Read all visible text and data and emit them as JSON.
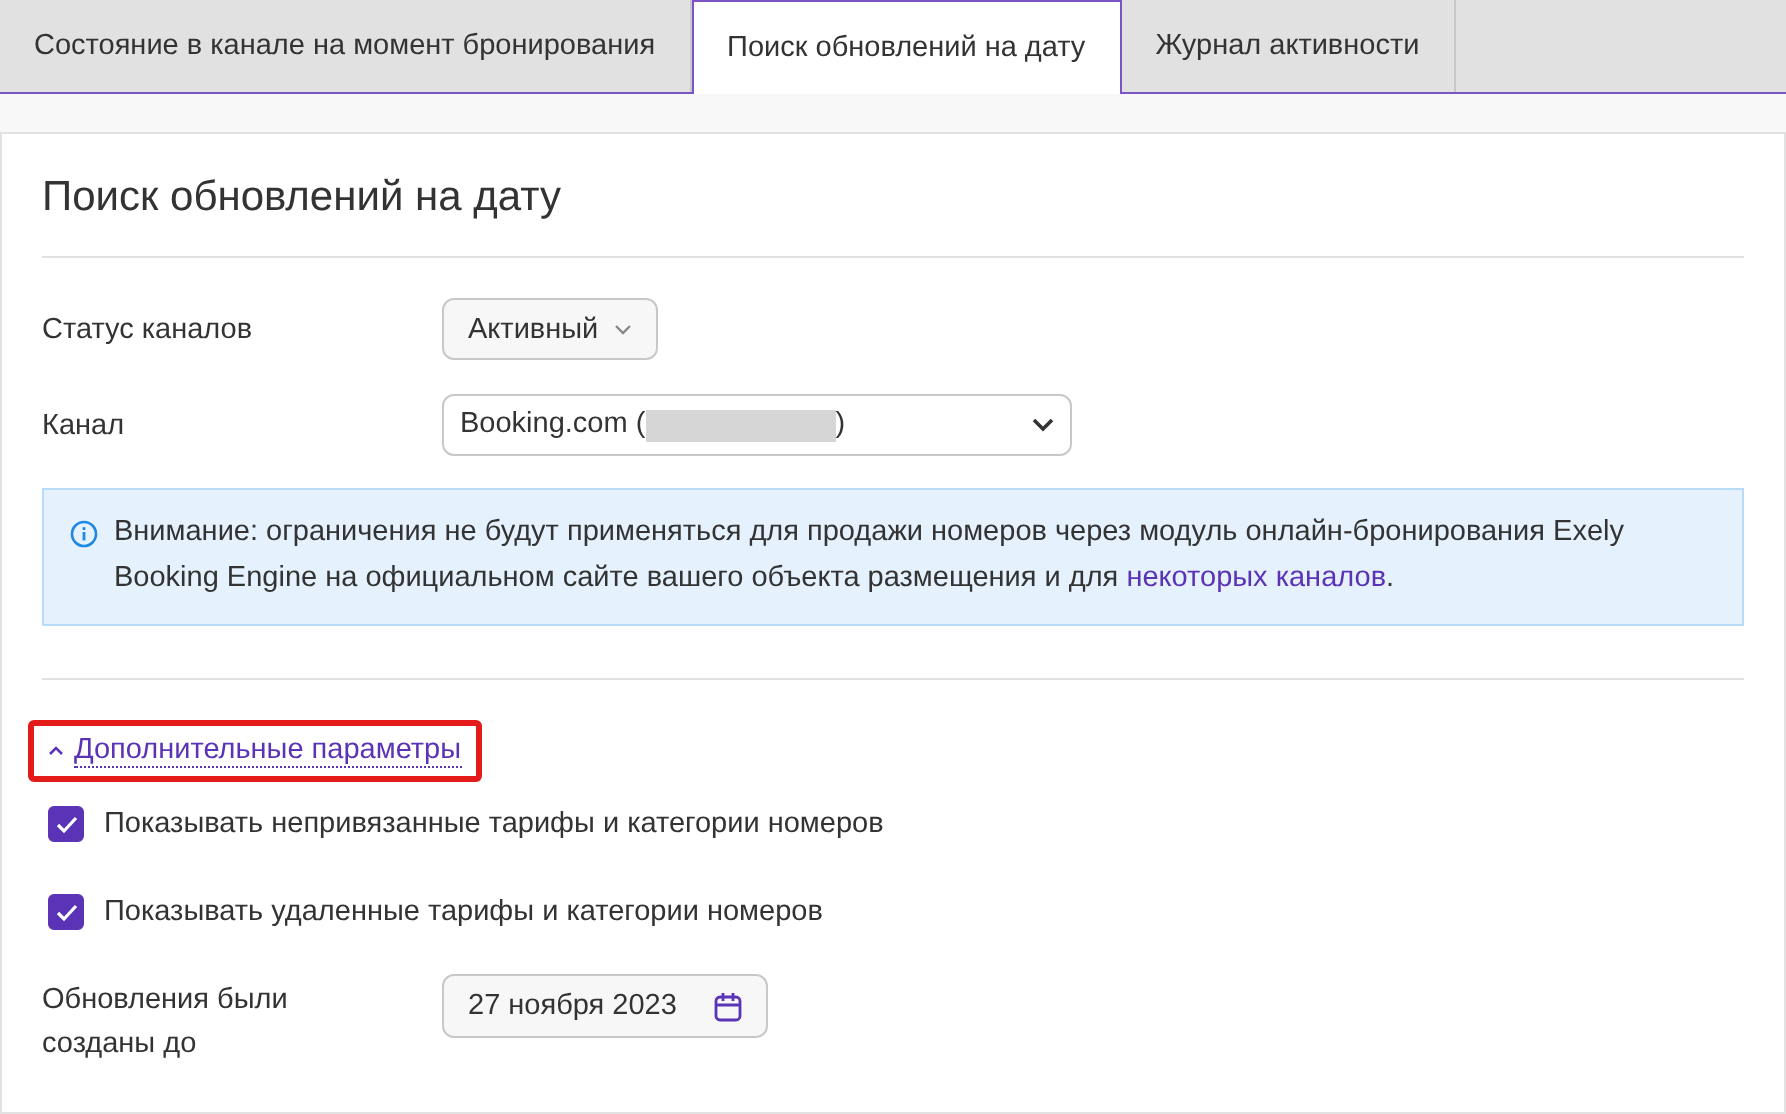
{
  "tabs": [
    {
      "label": "Состояние в канале на момент бронирования",
      "selected": false
    },
    {
      "label": "Поиск обновлений на дату",
      "selected": true
    },
    {
      "label": "Журнал активности",
      "selected": false
    }
  ],
  "panel": {
    "title": "Поиск обновлений на дату",
    "channel_status": {
      "label": "Статус каналов",
      "value": "Активный"
    },
    "channel": {
      "label": "Канал",
      "value_before": "Booking.com (",
      "value_after": ")",
      "redacted": true
    },
    "notice": {
      "text": "Внимание: ограничения не будут применяться для продажи номеров через модуль онлайн-бронирования Exely Booking Engine на официальном сайте вашего объекта размещения и для",
      "link": "некоторых каналов",
      "end": "."
    },
    "advanced": {
      "label": "Дополнительные параметры",
      "expanded": true,
      "highlighted": true
    },
    "options": [
      {
        "label": "Показывать непривязанные тарифы и категории номеров",
        "checked": true
      },
      {
        "label": "Показывать удаленные тарифы и категории номеров",
        "checked": true
      }
    ],
    "date": {
      "label": "Обновления были созданы до",
      "value": "27 ноября 2023"
    }
  }
}
